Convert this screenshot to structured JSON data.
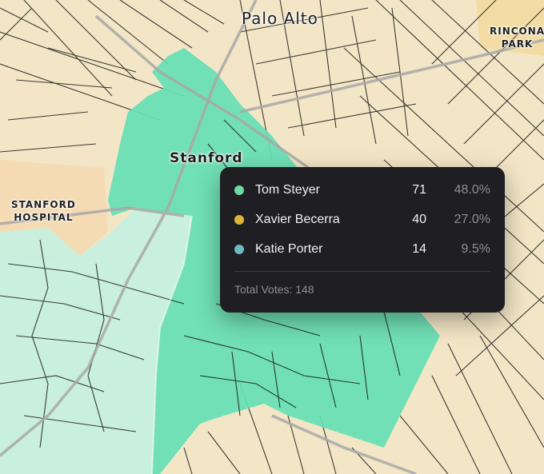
{
  "map": {
    "place_labels": {
      "palo_alto": "Palo Alto",
      "stanford": "Stanford",
      "stanford_hospital": [
        "STANFORD",
        "HOSPITAL"
      ],
      "rincon_park": [
        "RINCONA",
        "PARK"
      ]
    },
    "colors": {
      "land": "#f3e6c6",
      "road": "#1c1c1c",
      "major_road": "#9c9c9c",
      "region_primary": "#66e0b4",
      "region_light": "#c6f0e0"
    }
  },
  "tooltip": {
    "candidates": [
      {
        "name": "Tom Steyer",
        "votes": "71",
        "percent": "48.0%",
        "color": "#6ed9a4"
      },
      {
        "name": "Xavier Becerra",
        "votes": "40",
        "percent": "27.0%",
        "color": "#e0b43a"
      },
      {
        "name": "Katie Porter",
        "votes": "14",
        "percent": "9.5%",
        "color": "#6fb8c0"
      }
    ],
    "total_label": "Total Votes: 148"
  }
}
